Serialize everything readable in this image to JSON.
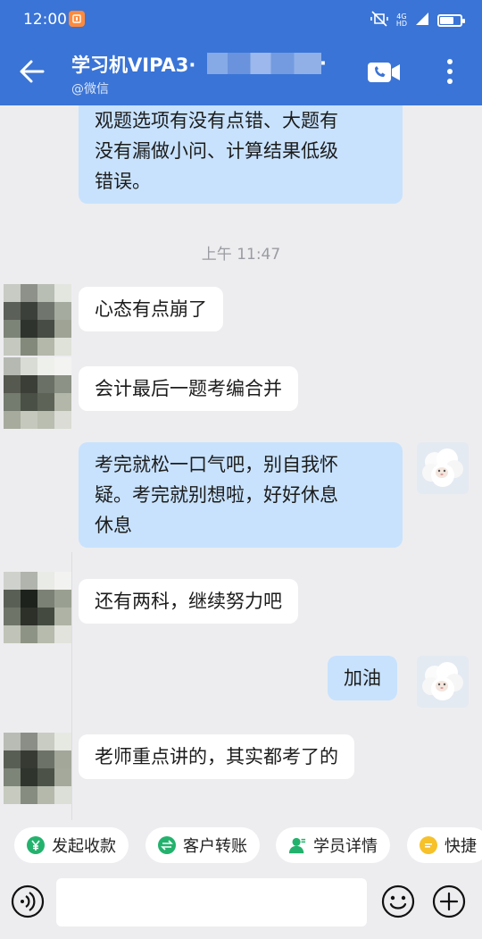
{
  "status_bar": {
    "time": "12:00",
    "network": "4G",
    "hd": "HD",
    "battery_level": 0.7
  },
  "header": {
    "title": "学习机VIPA3·",
    "title_suffix": "·",
    "subtitle": "@微信"
  },
  "messages": [
    {
      "side": "right",
      "lines": [
        "观题选项有没有点错、大题有",
        "没有漏做小问、计算结果低级",
        "错误。"
      ]
    },
    {
      "side": "timestamp",
      "text": "上午 11:47"
    },
    {
      "side": "left",
      "text": "心态有点崩了"
    },
    {
      "side": "left",
      "text": "会计最后一题考编合并"
    },
    {
      "side": "right",
      "lines": [
        "考完就松一口气吧，别自我怀",
        "疑。考完就别想啦，好好休息",
        "休息"
      ]
    },
    {
      "side": "left",
      "text": "还有两科，继续努力吧"
    },
    {
      "side": "right",
      "text": "加油"
    },
    {
      "side": "left",
      "text": "老师重点讲的，其实都考了的"
    }
  ],
  "quick_actions": [
    "发起收款",
    "客户转账",
    "学员详情",
    "快捷"
  ],
  "colors": {
    "header": "#3a74d6",
    "bubble_me": "#c8e2fd",
    "bubble_other": "#ffffff",
    "chat_bg": "#ededf0"
  },
  "icons": [
    "back-arrow-icon",
    "video-call-icon",
    "more-vertical-icon",
    "voice-icon",
    "emoji-icon",
    "plus-icon",
    "yen-icon",
    "transfer-icon",
    "user-icon",
    "chat-icon"
  ]
}
